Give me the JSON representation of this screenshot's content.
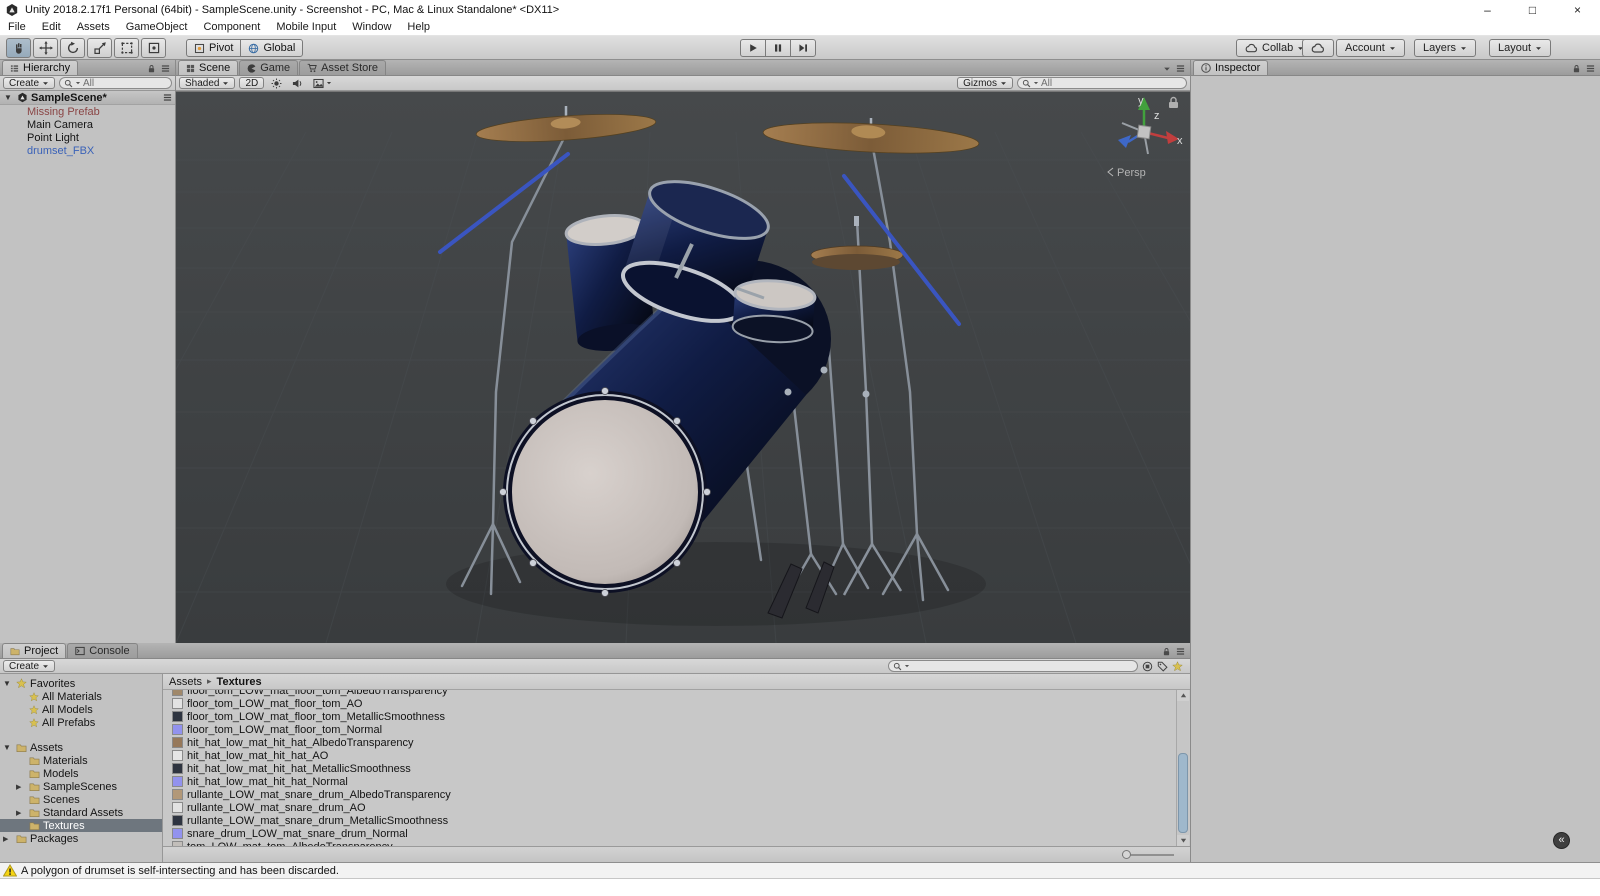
{
  "window": {
    "title": "Unity 2018.2.17f1 Personal (64bit) - SampleScene.unity - Screenshot - PC, Mac & Linux Standalone* <DX11>",
    "minimize": "–",
    "maximize": "□",
    "close": "×"
  },
  "menubar": {
    "items": [
      {
        "label": "File"
      },
      {
        "label": "Edit"
      },
      {
        "label": "Assets"
      },
      {
        "label": "GameObject"
      },
      {
        "label": "Component"
      },
      {
        "label": "Mobile Input"
      },
      {
        "label": "Window"
      },
      {
        "label": "Help"
      }
    ]
  },
  "toolbar": {
    "pivot": "Pivot",
    "global": "Global",
    "collab": "Collab",
    "account": "Account",
    "layers": "Layers",
    "layout": "Layout"
  },
  "hierarchy": {
    "tab": "Hierarchy",
    "create": "Create",
    "search_value": "All",
    "scene_foldout": "▼",
    "scene_name": "SampleScene*",
    "items": [
      {
        "label": "Missing Prefab",
        "color": "#8a4545"
      },
      {
        "label": "Main Camera"
      },
      {
        "label": "Point Light"
      },
      {
        "label": "drumset_FBX",
        "color": "#3a62b8"
      }
    ]
  },
  "scene_view": {
    "tab_scene": "Scene",
    "tab_game": "Game",
    "tab_store": "Asset Store",
    "shading": "Shaded",
    "toggle_2d": "2D",
    "gizmos": "Gizmos",
    "search_value": "All",
    "axis_x": "x",
    "axis_y": "y",
    "axis_z": "z",
    "projection": "Persp"
  },
  "inspector": {
    "tab": "Inspector",
    "collapse_glyph": "«"
  },
  "project": {
    "tab_project": "Project",
    "tab_console": "Console",
    "create": "Create",
    "favorites_foldout": "▼",
    "favorites_label": "Favorites",
    "favorites": [
      {
        "label": "All Materials"
      },
      {
        "label": "All Models"
      },
      {
        "label": "All Prefabs"
      }
    ],
    "assets_foldout": "▼",
    "assets_label": "Assets",
    "folders": [
      {
        "label": "Materials",
        "arrow": ""
      },
      {
        "label": "Models",
        "arrow": ""
      },
      {
        "label": "SampleScenes",
        "arrow": "▶"
      },
      {
        "label": "Scenes",
        "arrow": ""
      },
      {
        "label": "Standard Assets",
        "arrow": "▶"
      },
      {
        "label": "Textures",
        "arrow": "",
        "state": "selected"
      }
    ],
    "packages_arrow": "▶",
    "packages_label": "Packages",
    "crumb_root": "Assets",
    "crumb_sep": "▸",
    "crumb_current": "Textures",
    "files": [
      {
        "name": "floor_tom_LOW_mat_floor_tom_AlbedoTransparency",
        "icon": "#a0886a"
      },
      {
        "name": "floor_tom_LOW_mat_floor_tom_AO",
        "icon": "#e2e2e2"
      },
      {
        "name": "floor_tom_LOW_mat_floor_tom_MetallicSmoothness",
        "icon": "#2e3440"
      },
      {
        "name": "floor_tom_LOW_mat_floor_tom_Normal",
        "icon": "#9292ee"
      },
      {
        "name": "hit_hat_low_mat_hit_hat_AlbedoTransparency",
        "icon": "#96785a"
      },
      {
        "name": "hit_hat_low_mat_hit_hat_AO",
        "icon": "#e6e6e6"
      },
      {
        "name": "hit_hat_low_mat_hit_hat_MetallicSmoothness",
        "icon": "#2e3440"
      },
      {
        "name": "hit_hat_low_mat_hit_hat_Normal",
        "icon": "#9292ee"
      },
      {
        "name": "rullante_LOW_mat_snare_drum_AlbedoTransparency",
        "icon": "#b29878"
      },
      {
        "name": "rullante_LOW_mat_snare_drum_AO",
        "icon": "#e2e2e2"
      },
      {
        "name": "rullante_LOW_mat_snare_drum_MetallicSmoothness",
        "icon": "#2e3440"
      },
      {
        "name": "snare_drum_LOW_mat_snare_drum_Normal",
        "icon": "#9292ee"
      },
      {
        "name": "tom_LOW_mat_tom_AlbedoTransparency",
        "icon": "#c2beba"
      }
    ]
  },
  "statusbar": {
    "message": "A polygon of drumset is self-intersecting and has been discarded."
  }
}
